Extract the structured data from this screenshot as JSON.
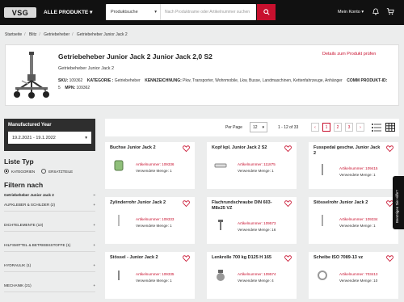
{
  "header": {
    "logo": "VSG",
    "all_products": "ALLE PRODUKTE",
    "search_dropdown": "Produktsuche",
    "search_placeholder": "Nach Produktname oder Artikelnummer suchen",
    "account": "Mein Konto"
  },
  "breadcrumb": [
    "Startseite",
    "Blitz",
    "Getriebeheber",
    "Getriebeheber Junior Jack 2"
  ],
  "product": {
    "title": "Getriebeheber Junior Jack 2 Junior Jack 2,0 S2",
    "subtitle": "Getriebeheber Junior Jack 2",
    "details_link": "Details zum Produkt prüfen",
    "sku_label": "SKU:",
    "sku": "109362",
    "kategorie_label": "KATEGORIE :",
    "kategorie": "Getriebeheber",
    "kennzeichnung_label": "KENNZEICHNUNG:",
    "kennzeichnung": "Pkw, Transporter, Wohnmobile, Lkw, Busse, Landmaschinen, Kettenfahrzeuge, Anhänger",
    "comm_label": "COMM PRODUKT-ID:",
    "comm": "5",
    "mpn_label": "MPN:",
    "mpn": "109362"
  },
  "filters": {
    "year_label": "Manufactured Year",
    "year_value": "19.2.2021 - 19.1.2022",
    "liste_typ": "Liste Typ",
    "radio_kategorien": "KATEGORIEN",
    "radio_ersatzteile": "ERSATZTEILE",
    "filtern_nach": "Filtern nach",
    "items": [
      {
        "label": "Getriebeheber Junior Jack 2",
        "sign": "−"
      },
      {
        "label": "AUFKLEBER & SCHILDER (2)",
        "sign": "+"
      },
      {
        "label": "DICHTELEMENTE (10)",
        "sign": "+"
      },
      {
        "label": "HILFSMITTEL & BETRIEBSSTOFFE (1)",
        "sign": "+"
      },
      {
        "label": "HYDRAULIK (1)",
        "sign": "+"
      },
      {
        "label": "MECHANIK (21)",
        "sign": "+"
      }
    ]
  },
  "toolbar": {
    "per_page_label": "Per Page",
    "per_page_value": "12",
    "count": "1 - 12 of 33",
    "pages": [
      "‹",
      "1",
      "2",
      "3",
      "›"
    ]
  },
  "cards": [
    {
      "title": "Buchse Junior Jack 2",
      "art": "Artikelnummer: 109336",
      "menge": "Verwendete Menge: 1"
    },
    {
      "title": "Kopf kpl. Junior Jack 2 S2",
      "art": "Artikelnummer: 111875",
      "menge": "Verwendete Menge: 1"
    },
    {
      "title": "Fusspedal geschw. Junior Jack 2",
      "art": "Artikelnummer: 109415",
      "menge": "Verwendete Menge: 1"
    },
    {
      "title": "Zylinderrohr Junior Jack 2",
      "art": "Artikelnummer: 109333",
      "menge": "Verwendete Menge: 1"
    },
    {
      "title": "Flachrundschraube DIN 603-M8x25 VZ",
      "art": "Artikelnummer: 109573",
      "menge": "Verwendete Menge: 16"
    },
    {
      "title": "Stösselrohr Junior Jack 2",
      "art": "Artikelnummer: 109334",
      "menge": "Verwendete Menge: 1"
    },
    {
      "title": "Stössel - Junior Jack 2",
      "art": "Artikelnummer: 109335",
      "menge": "Verwendete Menge: 1"
    },
    {
      "title": "Lenkrolle 700 kg D125 H 165",
      "art": "Artikelnummer: 109574",
      "menge": "Verwendete Menge: 4"
    },
    {
      "title": "Scheibe ISO 7089-13 vz",
      "art": "Artikelnummer: 703413",
      "menge": "Verwendete Menge: 10"
    }
  ],
  "help_tab": "Benötigen Sie Hilfe?",
  "colors": {
    "accent": "#c8102e",
    "topbar": "#111111"
  }
}
